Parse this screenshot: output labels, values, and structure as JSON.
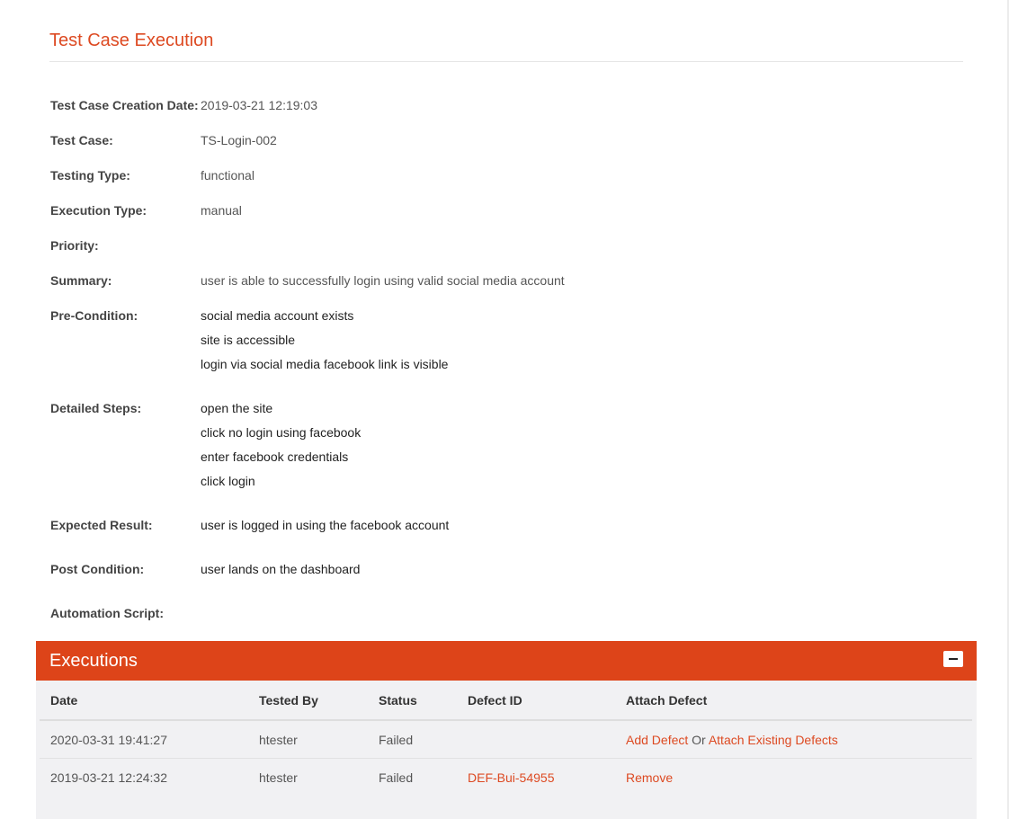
{
  "page": {
    "title": "Test Case Execution"
  },
  "details": {
    "creation_date": {
      "label": "Test Case Creation Date:",
      "value": "2019-03-21 12:19:03"
    },
    "test_case": {
      "label": "Test Case:",
      "value": "TS-Login-002"
    },
    "testing_type": {
      "label": "Testing Type:",
      "value": "functional"
    },
    "execution_type": {
      "label": "Execution Type:",
      "value": "manual"
    },
    "priority": {
      "label": "Priority:",
      "value": ""
    },
    "summary": {
      "label": "Summary:",
      "value": "user is able to successfully login using valid social media account"
    },
    "pre_condition": {
      "label": "Pre-Condition:",
      "lines": [
        "social media account exists",
        "site is accessible",
        "login via social media facebook link is visible"
      ]
    },
    "detailed_steps": {
      "label": "Detailed Steps:",
      "lines": [
        "open the site",
        "click no login using facebook",
        "enter facebook credentials",
        "click login"
      ]
    },
    "expected_result": {
      "label": "Expected Result:",
      "value": "user is logged in using the facebook account"
    },
    "post_condition": {
      "label": "Post Condition:",
      "value": "user lands on the dashboard"
    },
    "automation_script": {
      "label": "Automation Script:",
      "value": ""
    }
  },
  "executions": {
    "title": "Executions",
    "collapse_icon": "minus-icon",
    "columns": [
      "Date",
      "Tested By",
      "Status",
      "Defect ID",
      "Attach Defect"
    ],
    "rows": [
      {
        "date": "2020-03-31 19:41:27",
        "tested_by": "htester",
        "status": "Failed",
        "defect_id": "",
        "attach": {
          "add_defect": "Add Defect",
          "or": "Or",
          "attach_existing": "Attach Existing Defects"
        }
      },
      {
        "date": "2019-03-21 12:24:32",
        "tested_by": "htester",
        "status": "Failed",
        "defect_id": "DEF-Bui-54955",
        "attach": {
          "remove": "Remove"
        }
      }
    ]
  },
  "colors": {
    "accent": "#dd4419",
    "link": "#dd4a22",
    "panel_bg": "#f1f1f3"
  }
}
